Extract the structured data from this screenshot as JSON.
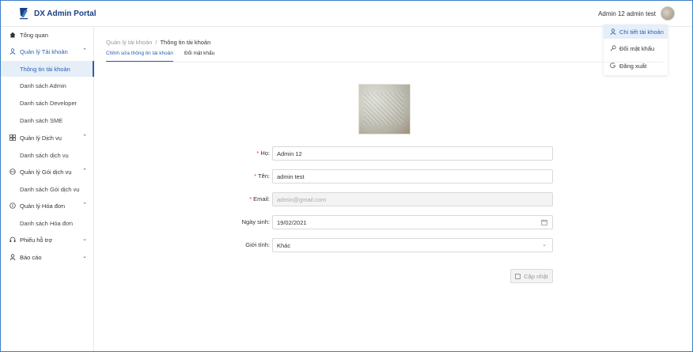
{
  "header": {
    "app_title": "DX Admin Portal",
    "user_name": "Admin 12 admin test"
  },
  "user_menu": {
    "items": [
      {
        "label": "Chi tiết tài khoản",
        "icon": "user-icon",
        "active": true
      },
      {
        "label": "Đổi mật khẩu",
        "icon": "key-icon",
        "active": false
      },
      {
        "label": "Đăng xuất",
        "icon": "logout-icon",
        "active": false
      }
    ]
  },
  "sidebar": {
    "overview": "Tổng quan",
    "account_mgmt": "Quản lý Tài khoản",
    "account_info": "Thông tin tài khoản",
    "admin_list": "Danh sách Admin",
    "developer_list": "Danh sách Developer",
    "sme_list": "Danh sách SME",
    "service_mgmt": "Quản lý Dịch vụ",
    "service_list": "Danh sách dịch vụ",
    "package_mgmt": "Quản lý Gói dịch vụ",
    "package_list": "Danh sách Gói dịch vụ",
    "invoice_mgmt": "Quản lý Hóa đơn",
    "invoice_list": "Danh sách Hóa đơn",
    "support_ticket": "Phiếu hỗ trợ",
    "reports": "Báo cáo"
  },
  "breadcrumb": {
    "parent": "Quản lý tài khoản",
    "separator": "/",
    "current": "Thông tin tài khoản"
  },
  "tabs": {
    "edit_info": "Chỉnh sửa thông tin tài khoản",
    "change_password": "Đổi mật khẩu"
  },
  "form": {
    "last_name_label": "Họ:",
    "last_name_value": "Admin 12",
    "first_name_label": "Tên:",
    "first_name_value": "admin test",
    "email_label": "Email:",
    "email_value": "admin@gmail.com",
    "dob_label": "Ngày sinh:",
    "dob_value": "19/02/2021",
    "gender_label": "Giới tính:",
    "gender_value": "Khác",
    "required_mark": "*",
    "update_button": "Cập nhật"
  },
  "colors": {
    "accent": "#2a5fb2",
    "brand": "#1b3f84",
    "required": "#ee3333"
  }
}
